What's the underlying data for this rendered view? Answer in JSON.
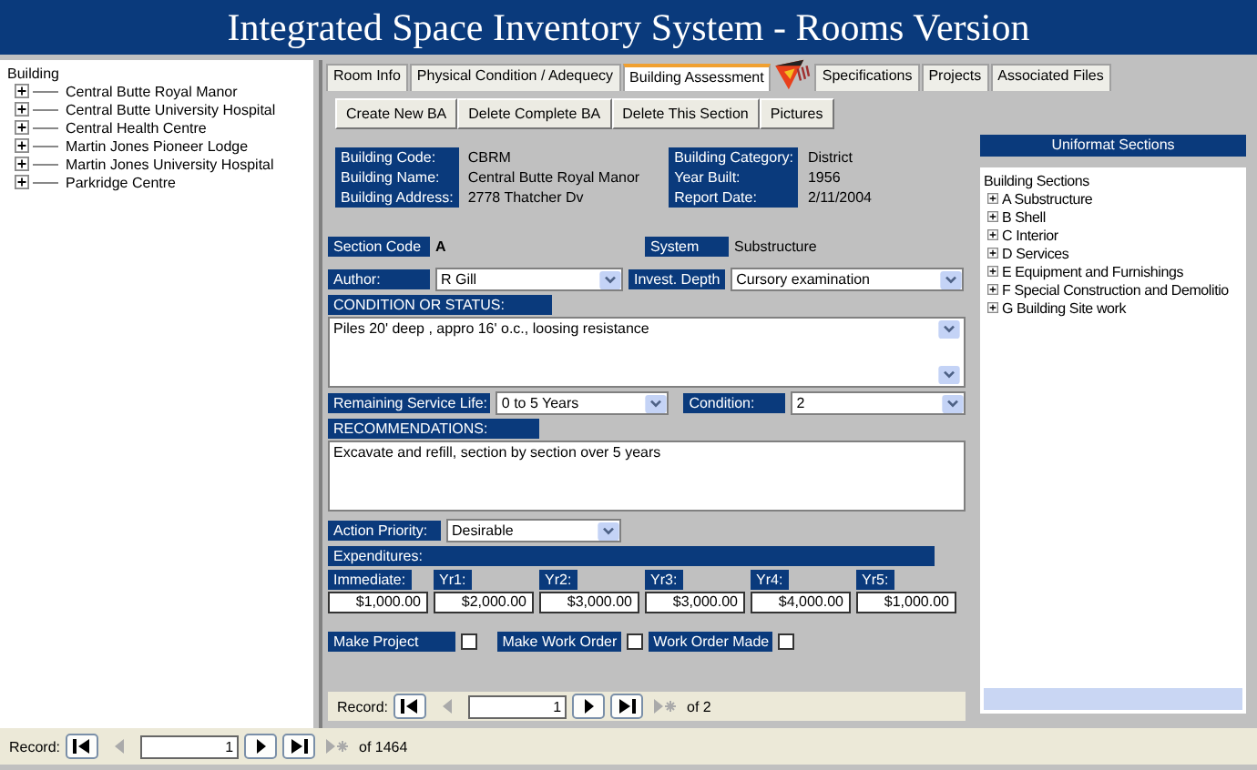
{
  "window": {
    "title": "Integrated Space Inventory System - Rooms Version"
  },
  "building_tree": {
    "root": "Building",
    "children": [
      {
        "label": "Central Butte Royal Manor",
        "expanded": false
      },
      {
        "label": "Central Butte University Hospital",
        "expanded": false
      },
      {
        "label": "Central Health Centre",
        "expanded": false
      },
      {
        "label": "Martin Jones Pioneer Lodge",
        "expanded": false
      },
      {
        "label": "Martin Jones University Hospital",
        "expanded": false
      },
      {
        "label": "Parkridge Centre",
        "expanded": false
      }
    ]
  },
  "tabs": [
    {
      "label": "Room Info",
      "selected": false
    },
    {
      "label": "Physical Condition / Adequecy",
      "selected": false
    },
    {
      "label": "Building Assessment",
      "selected": true
    },
    {
      "label": "Specifications",
      "selected": false
    },
    {
      "label": "Projects",
      "selected": false
    },
    {
      "label": "Associated Files",
      "selected": false
    }
  ],
  "toolbar": [
    "Create New BA",
    "Delete Complete BA",
    "Delete This Section",
    "Pictures"
  ],
  "building_info": {
    "left": [
      {
        "label": "Building Code:",
        "value": "CBRM"
      },
      {
        "label": "Building Name:",
        "value": "Central Butte Royal Manor"
      },
      {
        "label": "Building Address:",
        "value": "2778 Thatcher Dv"
      }
    ],
    "right": [
      {
        "label": "Building Category:",
        "value": "District"
      },
      {
        "label": "Year Built:",
        "value": "1956"
      },
      {
        "label": "Report Date:",
        "value": "2/11/2004"
      }
    ]
  },
  "section_code": {
    "label": "Section Code",
    "value": "A"
  },
  "system": {
    "label": "System",
    "value": "Substructure"
  },
  "author": {
    "label": "Author:",
    "value": "R Gill"
  },
  "invest_depth": {
    "label": "Invest. Depth",
    "value": "Cursory examination"
  },
  "condition_status": {
    "label": "CONDITION OR STATUS:",
    "value": "Piles 20' deep , appro 16' o.c., loosing resistance"
  },
  "remaining_service_life": {
    "label": "Remaining Service Life:",
    "value": "0 to 5 Years"
  },
  "condition": {
    "label": "Condition:",
    "value": "2"
  },
  "recommendations": {
    "label": "RECOMMENDATIONS:",
    "value": "Excavate and refill, section by section over 5 years"
  },
  "action_priority": {
    "label": "Action Priority:",
    "value": "Desirable"
  },
  "expenditures": {
    "label": "Expenditures:",
    "items": [
      {
        "label": "Immediate:",
        "value": "$1,000.00"
      },
      {
        "label": "Yr1:",
        "value": "$2,000.00"
      },
      {
        "label": "Yr2:",
        "value": "$3,000.00"
      },
      {
        "label": "Yr3:",
        "value": "$3,000.00"
      },
      {
        "label": "Yr4:",
        "value": "$4,000.00"
      },
      {
        "label": "Yr5:",
        "value": "$1,000.00"
      }
    ]
  },
  "checkboxes": [
    {
      "label": "Make Project",
      "checked": false
    },
    {
      "label": "Make Work Order",
      "checked": false
    },
    {
      "label": "Work Order Made",
      "checked": false
    }
  ],
  "subform_nav": {
    "label": "Record:",
    "current": "1",
    "total": "of  2"
  },
  "uniformat": {
    "title": "Uniformat Sections",
    "root": "Building Sections",
    "children": [
      {
        "label": "A Substructure",
        "expanded": false
      },
      {
        "label": "B Shell",
        "expanded": false
      },
      {
        "label": "C Interior",
        "expanded": false
      },
      {
        "label": "D Services",
        "expanded": false
      },
      {
        "label": "E Equipment and Furnishings",
        "expanded": false
      },
      {
        "label": "F Special Construction and Demolitio",
        "expanded": false
      },
      {
        "label": "G Building Site work",
        "expanded": false
      }
    ]
  },
  "record_nav": {
    "label": "Record:",
    "current": "1",
    "total": "of  1464"
  }
}
